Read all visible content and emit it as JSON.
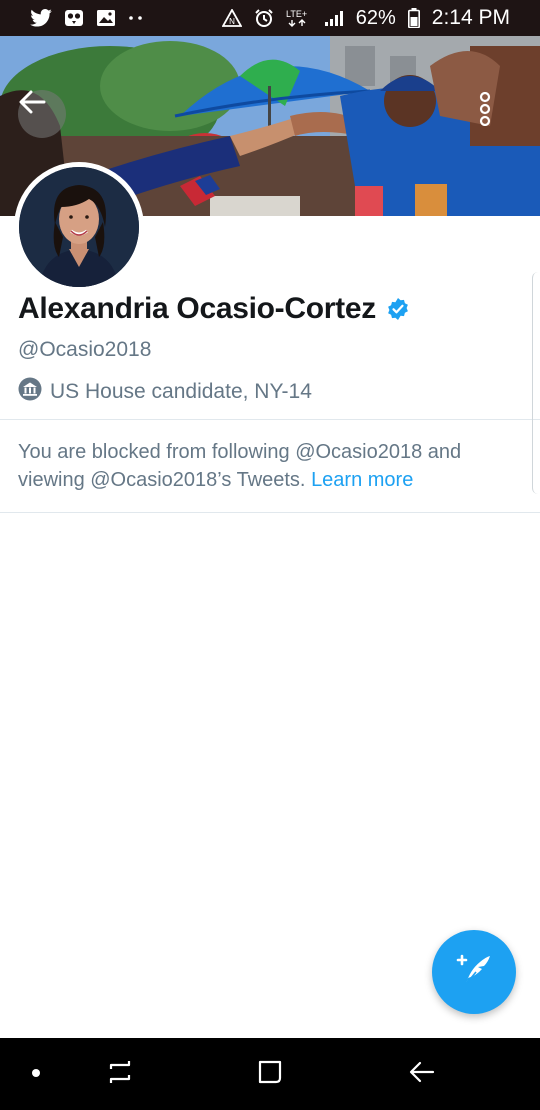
{
  "status_bar": {
    "battery_percent": "62%",
    "time": "2:14 PM",
    "network": "LTE+",
    "left_icons": [
      "twitter-icon",
      "owl-icon",
      "image-icon",
      "more-dots-icon"
    ],
    "right_icons": [
      "nfc-icon",
      "alarm-icon",
      "lte-icon",
      "signal-icon",
      "battery-icon"
    ]
  },
  "header": {
    "back_icon": "arrow-left-icon",
    "more_icon": "more-vertical-icon"
  },
  "profile": {
    "name": "Alexandria Ocasio-Cortez",
    "verified": true,
    "handle": "@Ocasio2018",
    "bio": "US House candidate, NY-14",
    "bio_icon": "government-building-icon"
  },
  "blocked_notice": {
    "text": "You are blocked from following @Ocasio2018 and viewing @Ocasio2018’s Tweets.",
    "link": "Learn more"
  },
  "fab": {
    "icon": "compose-tweet-icon"
  },
  "nav_bar": {
    "icons": [
      "dot-icon",
      "recent-apps-icon",
      "home-icon",
      "back-icon"
    ]
  },
  "colors": {
    "accent": "#1da1f2",
    "secondary_text": "#657786",
    "primary_text": "#14171a",
    "status_bar": "#1e1414",
    "nav_bar": "#000000"
  }
}
